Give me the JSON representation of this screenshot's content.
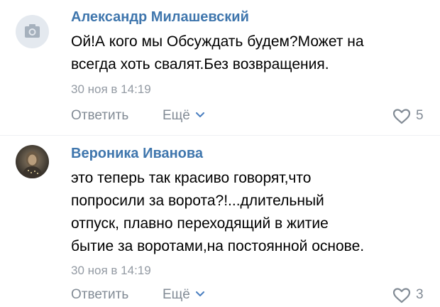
{
  "comments": [
    {
      "author": "Александр Милашевский",
      "avatar": "camera-placeholder-icon",
      "text": "Ой!А кого мы Обсуждать будем?Может на\nвсегда хоть свалят.Без возвращения.",
      "time": "30 ноя в 14:19",
      "reply_label": "Ответить",
      "more_label": "Ещё",
      "likes": "5"
    },
    {
      "author": "Вероника Иванова",
      "avatar": "user-photo",
      "text": "это теперь так красиво говорят,что\nпопросили за ворота?!...длительный\nотпуск, плавно переходящий в житие\nбытие за воротами,на постоянной основе.",
      "time": "30 ноя в 14:19",
      "reply_label": "Ответить",
      "more_label": "Ещё",
      "likes": "3"
    }
  ],
  "colors": {
    "author": "#3f76ad",
    "meta": "#939aa3",
    "action": "#828b95",
    "text": "#000000"
  }
}
